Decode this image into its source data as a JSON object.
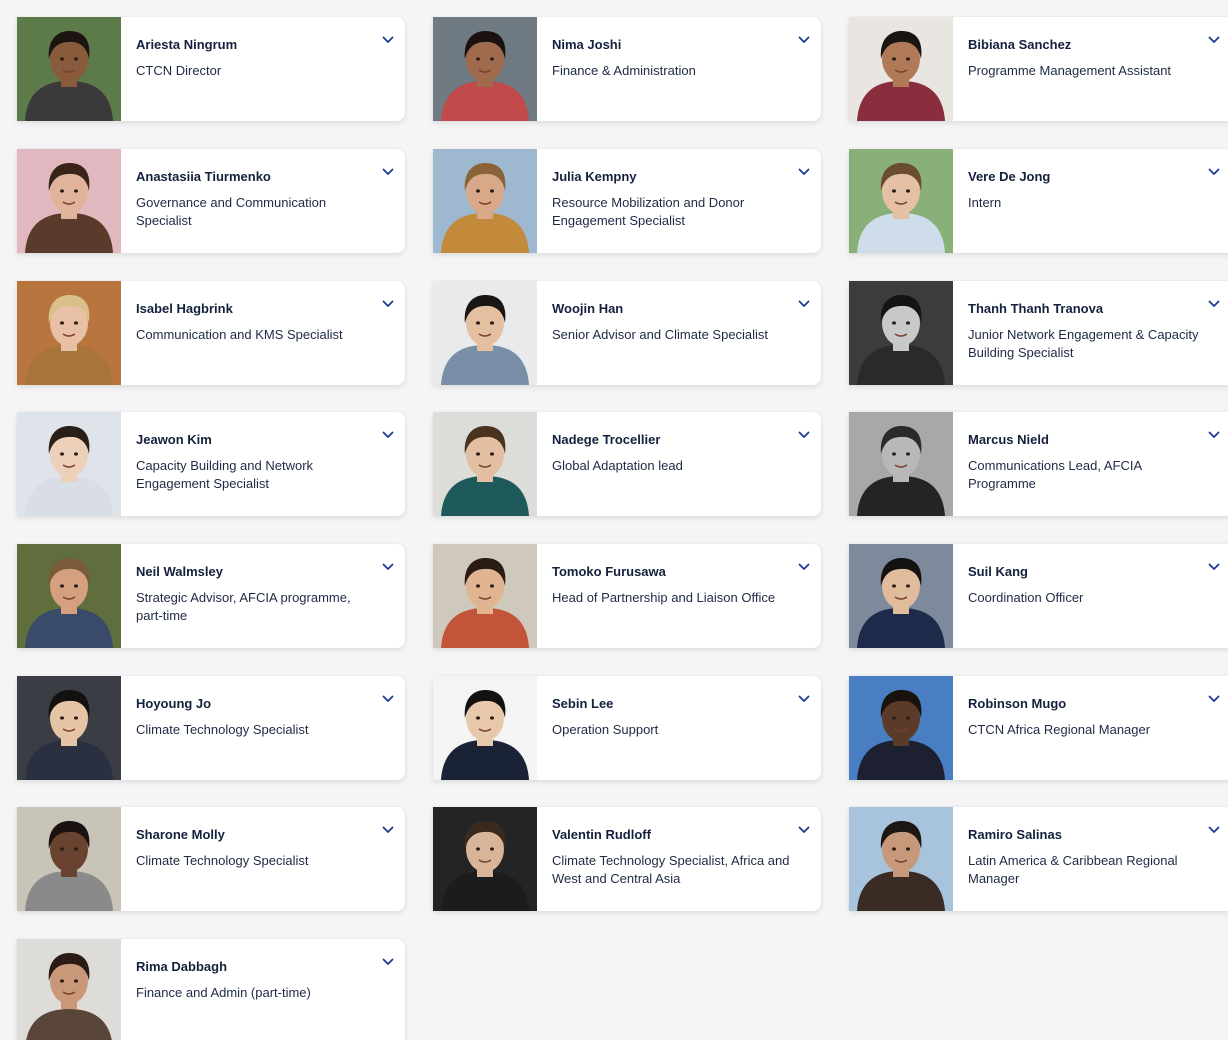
{
  "icon_color": "#1f3a93",
  "toggle_icon": "chevron-down-icon",
  "people": [
    {
      "name": "Ariesta Ningrum",
      "role": "CTCN Director",
      "bg": "#5d7a4a",
      "skin": "#8a5a3c",
      "hair": "#1c1410",
      "shirt": "#3a3a3a"
    },
    {
      "name": "Nima Joshi",
      "role": "Finance & Administration",
      "bg": "#6f7a82",
      "skin": "#a06a4c",
      "hair": "#1a1210",
      "shirt": "#c24a4a"
    },
    {
      "name": "Bibiana Sanchez",
      "role": "Programme Management Assistant",
      "bg": "#e9e6e2",
      "skin": "#b07a58",
      "hair": "#1a1412",
      "shirt": "#8a2e3e"
    },
    {
      "name": "Anastasiia Tiurmenko",
      "role": "Governance and Communication Specialist",
      "bg": "#e2b8c0",
      "skin": "#e0b49a",
      "hair": "#3a2418",
      "shirt": "#5a3a2a"
    },
    {
      "name": "Julia Kempny",
      "role": "Resource Mobilization and Donor Engagement Specialist",
      "bg": "#9db8cf",
      "skin": "#d8a888",
      "hair": "#8a6438",
      "shirt": "#c28a3a"
    },
    {
      "name": "Vere De Jong",
      "role": "Intern",
      "bg": "#8ab07a",
      "skin": "#e6c0a4",
      "hair": "#6a4c30",
      "shirt": "#cfdcea"
    },
    {
      "name": "Isabel Hagbrink",
      "role": "Communication and KMS Specialist",
      "bg": "#b8763e",
      "skin": "#e8c0a6",
      "hair": "#d9c08a",
      "shirt": "#a8743a"
    },
    {
      "name": "Woojin Han",
      "role": "Senior Advisor and Climate Specialist",
      "bg": "#e8eaec",
      "skin": "#e4c0a0",
      "hair": "#1a1614",
      "shirt": "#7a8ea8"
    },
    {
      "name": "Thanh Thanh Tranova",
      "role": "Junior Network Engagement & Capacity Building Specialist",
      "bg": "#3c3c3c",
      "skin": "#c8c8c8",
      "hair": "#141414",
      "shirt": "#2a2a2a"
    },
    {
      "name": "Jeawon Kim",
      "role": "Capacity Building and Network Engagement Specialist",
      "bg": "#dfe4ea",
      "skin": "#ecd0ba",
      "hair": "#2a1e18",
      "shirt": "#d8dde6"
    },
    {
      "name": "Nadege Trocellier",
      "role": "Global Adaptation lead",
      "bg": "#dcdcd8",
      "skin": "#e4bea0",
      "hair": "#4a3220",
      "shirt": "#1f5a5a"
    },
    {
      "name": "Marcus Nield",
      "role": "Communications Lead, AFCIA Programme",
      "bg": "#a8a8a8",
      "skin": "#b8b8b8",
      "hair": "#2a2a2a",
      "shirt": "#242424"
    },
    {
      "name": "Neil Walmsley",
      "role": "Strategic Advisor, AFCIA programme, part-time",
      "bg": "#5f6e3c",
      "skin": "#d4a080",
      "hair": "#7a5a3a",
      "shirt": "#3a4a6a"
    },
    {
      "name": "Tomoko Furusawa",
      "role": "Head of Partnership and Liaison Office",
      "bg": "#cfc8bc",
      "skin": "#e0b490",
      "hair": "#2a1c14",
      "shirt": "#c2543a"
    },
    {
      "name": "Suil Kang",
      "role": "Coordination Officer",
      "bg": "#7c8a9c",
      "skin": "#e0bc9c",
      "hair": "#141210",
      "shirt": "#1e2a4a"
    },
    {
      "name": "Hoyoung Jo",
      "role": "Climate Technology Specialist",
      "bg": "#3a3e44",
      "skin": "#e6c4a6",
      "hair": "#141210",
      "shirt": "#2a3040"
    },
    {
      "name": "Sebin Lee",
      "role": "Operation Support",
      "bg": "#f4f4f4",
      "skin": "#e8c8aa",
      "hair": "#121010",
      "shirt": "#1a2236"
    },
    {
      "name": "Robinson Mugo",
      "role": "CTCN Africa Regional Manager",
      "bg": "#4a7ec2",
      "skin": "#5a3a28",
      "hair": "#1a120c",
      "shirt": "#1c2030"
    },
    {
      "name": "Sharone Molly",
      "role": "Climate Technology Specialist",
      "bg": "#c8c4b8",
      "skin": "#6a4230",
      "hair": "#1a1210",
      "shirt": "#8a8a8a"
    },
    {
      "name": "Valentin Rudloff",
      "role": "Climate Technology Specialist, Africa and West and Central Asia",
      "bg": "#222426",
      "skin": "#d8b498",
      "hair": "#3a2a1e",
      "shirt": "#1c1c1c"
    },
    {
      "name": "Ramiro Salinas",
      "role": "Latin America & Caribbean Regional Manager",
      "bg": "#a8c4dc",
      "skin": "#c8987a",
      "hair": "#1c1614",
      "shirt": "#3a2c24"
    },
    {
      "name": "Rima Dabbagh",
      "role": "Finance and Admin (part-time)",
      "bg": "#dedcd8",
      "skin": "#c89878",
      "hair": "#2a1c14",
      "shirt": "#5a4638"
    }
  ]
}
